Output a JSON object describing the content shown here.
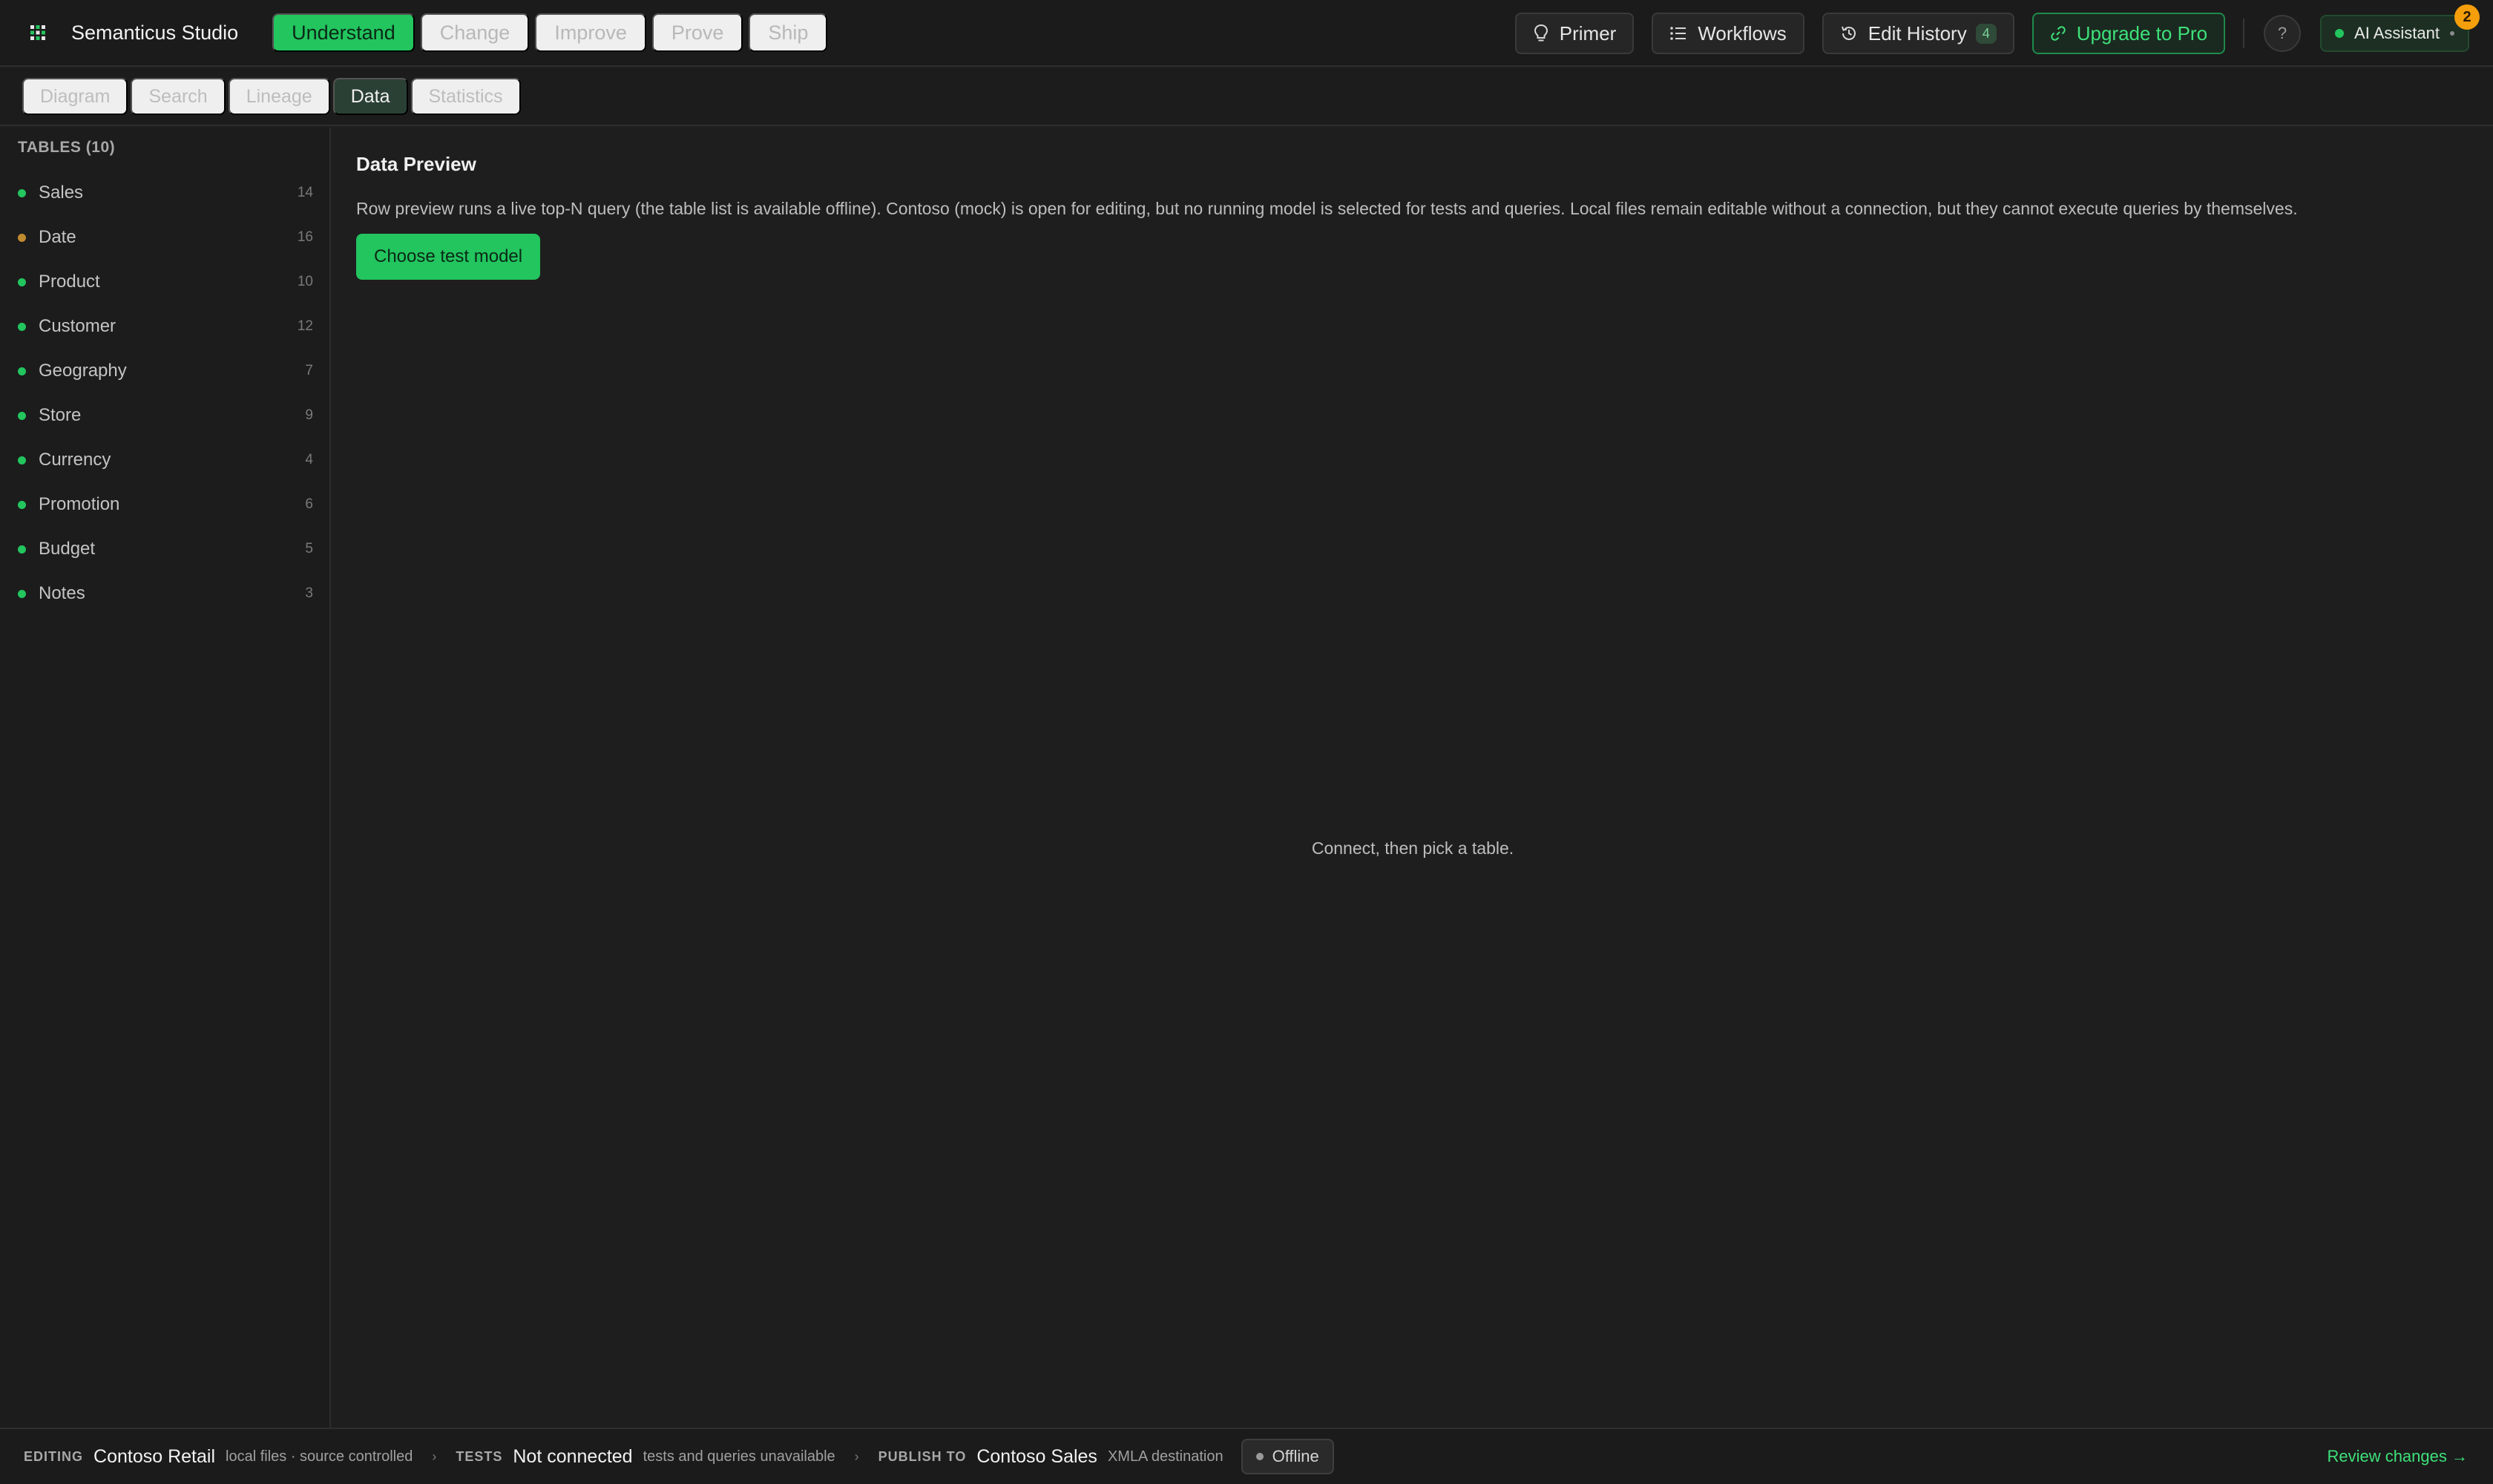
{
  "app": {
    "title": "Semanticus Studio"
  },
  "main_nav": [
    {
      "label": "Understand",
      "active": true
    },
    {
      "label": "Change",
      "active": false
    },
    {
      "label": "Improve",
      "active": false
    },
    {
      "label": "Prove",
      "active": false
    },
    {
      "label": "Ship",
      "active": false
    }
  ],
  "toolbar": {
    "primer_label": "Primer",
    "workflows_label": "Workflows",
    "edit_history_label": "Edit History",
    "edit_history_count": "4",
    "upgrade_label": "Upgrade to Pro",
    "help_label": "?",
    "ai_assistant_label": "AI Assistant",
    "ai_notification_count": "2"
  },
  "subtabs": [
    {
      "label": "Diagram",
      "active": false
    },
    {
      "label": "Search",
      "active": false
    },
    {
      "label": "Lineage",
      "active": false
    },
    {
      "label": "Data",
      "active": true
    },
    {
      "label": "Statistics",
      "active": false
    }
  ],
  "sidebar": {
    "heading": "TABLES (10)",
    "tables": [
      {
        "name": "Sales",
        "count": "14",
        "dot": "#22c55e"
      },
      {
        "name": "Date",
        "count": "16",
        "dot": "#c08a2e"
      },
      {
        "name": "Product",
        "count": "10",
        "dot": "#22c55e"
      },
      {
        "name": "Customer",
        "count": "12",
        "dot": "#22c55e"
      },
      {
        "name": "Geography",
        "count": "7",
        "dot": "#22c55e"
      },
      {
        "name": "Store",
        "count": "9",
        "dot": "#22c55e"
      },
      {
        "name": "Currency",
        "count": "4",
        "dot": "#22c55e"
      },
      {
        "name": "Promotion",
        "count": "6",
        "dot": "#22c55e"
      },
      {
        "name": "Budget",
        "count": "5",
        "dot": "#22c55e"
      },
      {
        "name": "Notes",
        "count": "3",
        "dot": "#22c55e"
      }
    ]
  },
  "main": {
    "title": "Data Preview",
    "description": "Row preview runs a live top-N query (the table list is available offline). Contoso (mock) is open for editing, but no running model is selected for tests and queries. Local files remain editable without a connection, but they cannot execute queries by themselves.",
    "choose_button": "Choose test model",
    "empty_message": "Connect, then pick a table."
  },
  "statusbar": {
    "editing_label": "EDITING",
    "editing_value": "Contoso Retail",
    "editing_detail": "local files · source controlled",
    "tests_label": "TESTS",
    "tests_value": "Not connected",
    "tests_detail": "tests and queries unavailable",
    "publish_label": "PUBLISH TO",
    "publish_value": "Contoso Sales",
    "publish_detail": "XMLA destination",
    "offline_label": "Offline",
    "review_link": "Review changes →"
  },
  "colors": {
    "accent": "#22c55e",
    "background": "#1e1e1e",
    "notification": "#f59e0b"
  },
  "icons": {
    "brand": "grid-logo-icon",
    "primer": "lightbulb-icon",
    "workflows": "list-icon",
    "edit_history": "history-icon",
    "upgrade": "link-icon"
  }
}
